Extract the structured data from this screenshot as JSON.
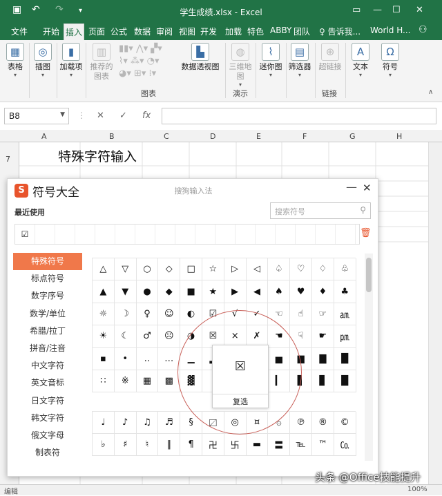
{
  "window": {
    "title": "学生成绩.xlsx - Excel",
    "tell_me": "告诉我...",
    "user": "World H..."
  },
  "tabs": [
    "文件",
    "开始",
    "插入",
    "页面",
    "公式",
    "数据",
    "审阅",
    "视图",
    "开发",
    "加载",
    "特色",
    "ABBY",
    "团队"
  ],
  "ribbon": {
    "buttons": [
      "表格",
      "插图",
      "加载项",
      "推荐的图表",
      "数据透视图",
      "三维地图",
      "迷你图",
      "筛选器",
      "超链接",
      "文本",
      "符号"
    ],
    "groups": [
      "图表",
      "演示",
      "链接"
    ]
  },
  "formula_bar": {
    "name_box": "B8",
    "fx": "fx",
    "formula": ""
  },
  "columns": [
    "A",
    "B",
    "C",
    "D",
    "E",
    "F",
    "G",
    "H"
  ],
  "sheet": {
    "row_label": "7",
    "title": "特殊字符输入",
    "status": "编辑",
    "zoom": "100%"
  },
  "symbol_panel": {
    "title": "符号大全",
    "subtitle": "搜狗输入法",
    "recent_label": "最近使用",
    "search_placeholder": "搜索符号",
    "recent": [
      "☑"
    ],
    "categories": [
      "特殊符号",
      "标点符号",
      "数字序号",
      "数学/单位",
      "希腊/拉丁",
      "拼音/注音",
      "中文字符",
      "英文音标",
      "日文字符",
      "韩文字符",
      "俄文字母",
      "制表符"
    ],
    "active_category": "特殊符号",
    "grid_symbols": [
      [
        "△",
        "▽",
        "○",
        "◇",
        "□",
        "☆",
        "▷",
        "◁",
        "♤",
        "♡",
        "♢",
        "♧"
      ],
      [
        "▲",
        "▼",
        "●",
        "◆",
        "■",
        "★",
        "▶",
        "◀",
        "♠",
        "♥",
        "♦",
        "♣"
      ],
      [
        "☼",
        "☽",
        "♀",
        "☺",
        "◐",
        "☑",
        "√",
        "✓",
        "☜",
        "☝",
        "☞",
        "㏂"
      ],
      [
        "☀",
        "☾",
        "♂",
        "☹",
        "◑",
        "☒",
        "×",
        "✗",
        "☚",
        "☟",
        "☛",
        "㏘"
      ],
      [
        "▪",
        "•",
        "‥",
        "…",
        "▁",
        "▂",
        "▃",
        "▄",
        "▅",
        "▆",
        "▇",
        "█"
      ],
      [
        "∷",
        "※",
        "▦",
        "▩",
        "▓",
        "▕",
        "▌",
        "▍",
        "▎",
        "▋",
        "▊",
        "█"
      ]
    ],
    "grid_symbols_2": [
      [
        "♩",
        "♪",
        "♫",
        "♬",
        "§",
        "〼",
        "◎",
        "¤",
        "۞",
        "℗",
        "®",
        "©"
      ],
      [
        "♭",
        "♯",
        "♮",
        "‖",
        "¶",
        "卍",
        "卐",
        "▬",
        "〓",
        "℡",
        "™",
        "㏇"
      ]
    ],
    "preview_symbol": "☒",
    "preview_action": "复选"
  },
  "watermark": "头条 @Office技能提升"
}
